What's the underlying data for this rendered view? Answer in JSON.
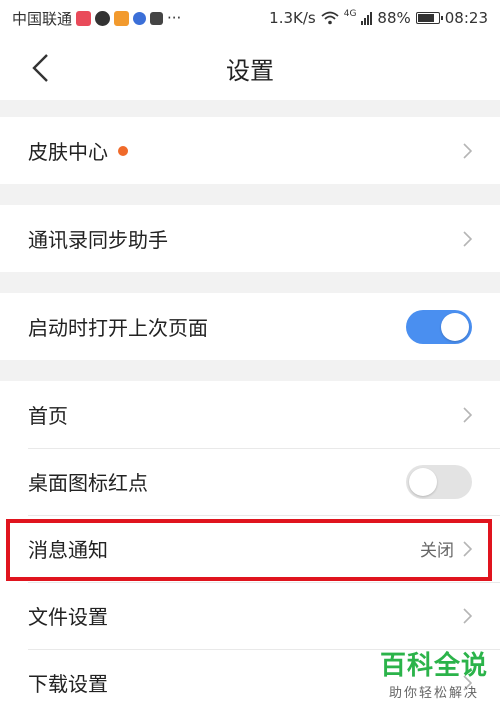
{
  "status_bar": {
    "carrier": "中国联通",
    "more": "···",
    "speed": "1.3K/s",
    "network": "4G",
    "battery": "88%",
    "battery_level": 0.88,
    "time": "08:23"
  },
  "header": {
    "title": "设置",
    "back_icon": "chevron-left-icon"
  },
  "groups": [
    {
      "items": [
        {
          "label": "皮肤中心",
          "badge": "red-dot",
          "control": "chevron"
        }
      ]
    },
    {
      "items": [
        {
          "label": "通讯录同步助手",
          "control": "chevron"
        }
      ]
    },
    {
      "items": [
        {
          "label": "启动时打开上次页面",
          "control": "toggle",
          "on": true
        }
      ]
    },
    {
      "items": [
        {
          "label": "首页",
          "control": "chevron"
        },
        {
          "label": "桌面图标红点",
          "control": "toggle",
          "on": false
        },
        {
          "label": "消息通知",
          "value": "关闭",
          "control": "chevron",
          "highlighted": true
        },
        {
          "label": "文件设置",
          "control": "chevron"
        },
        {
          "label": "下载设置",
          "control": "chevron"
        }
      ]
    }
  ],
  "colors": {
    "toggle_on": "#4a8ff0",
    "toggle_off": "#e3e3e3",
    "badge": "#f06a2a",
    "highlight_border": "#e0141e",
    "watermark": "#2bb34a"
  },
  "watermark": {
    "title": "百科全说",
    "subtitle": "助你轻松解决"
  }
}
